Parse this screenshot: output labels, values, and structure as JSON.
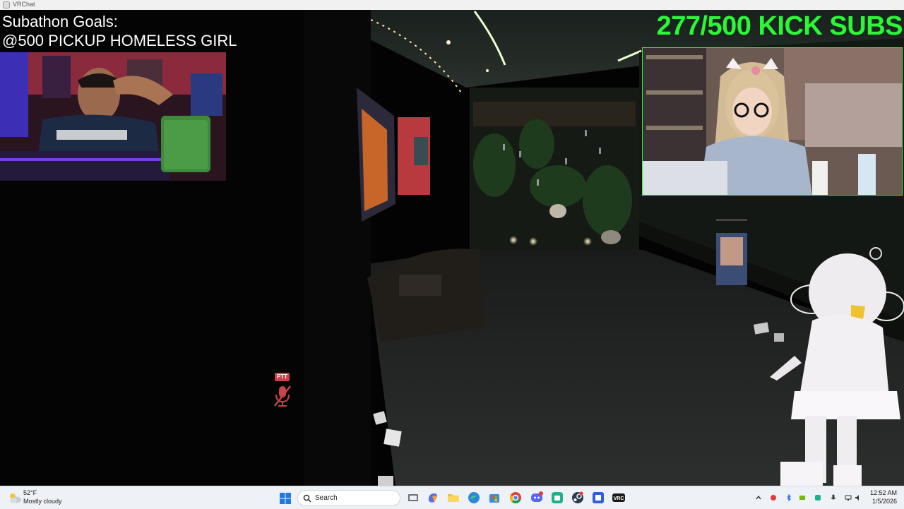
{
  "window": {
    "title": "VRChat",
    "icon": "vrchat-icon"
  },
  "overlay": {
    "goals_title": "Subathon Goals:",
    "goals_text": "@500 PICKUP HOMELESS GIRL",
    "sub_counter": "277/500 KICK SUBS",
    "counter_color": "#2ef53a"
  },
  "hud": {
    "ptt_label": "PTT",
    "mic_icon": "mic-muted-icon",
    "ptt_color": "#c8434a"
  },
  "taskbar": {
    "weather": {
      "temp": "52°F",
      "desc": "Mostly cloudy",
      "icon": "cloud-sun-icon"
    },
    "search_placeholder": "Search",
    "apps": [
      "file-explorer-icon",
      "copilot-icon",
      "folder-icon",
      "edge-icon",
      "store-icon",
      "chrome-icon",
      "discord-icon",
      "app-icon",
      "steam-icon",
      "app2-icon",
      "vrchat-taskbar-icon"
    ],
    "clock": {
      "time": "12:52 AM",
      "date": "1/5/2026"
    }
  }
}
